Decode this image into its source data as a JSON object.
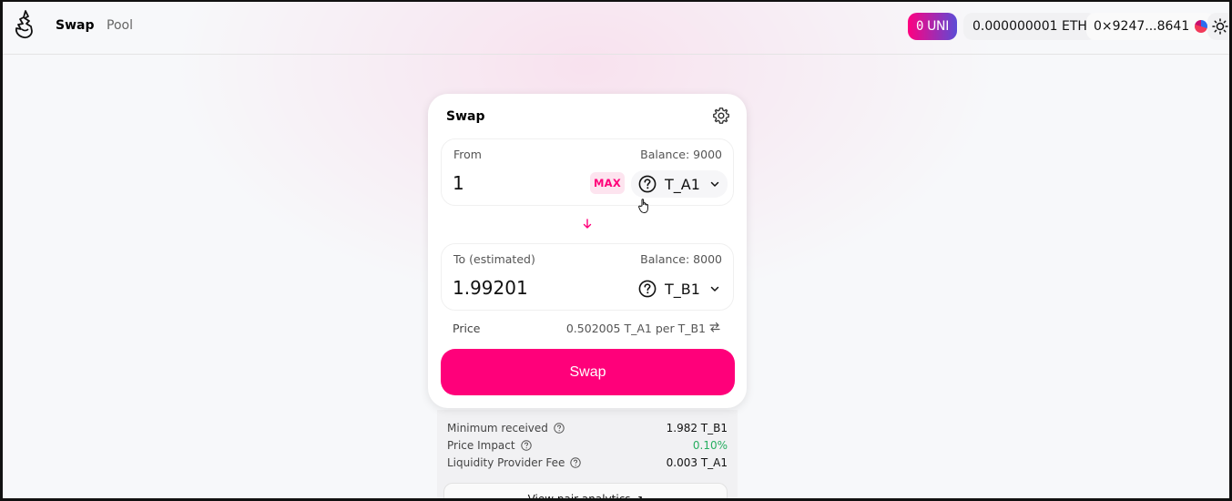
{
  "header": {
    "nav": {
      "swap": "Swap",
      "pool": "Pool"
    },
    "uni_balance": "0",
    "uni_label": "UNI",
    "eth_balance": "0.000000001 ETH",
    "account": "0×9247...8641",
    "icons": [
      "logo-icon",
      "avatar-icon",
      "sun-icon"
    ]
  },
  "swap_card": {
    "title": "Swap",
    "from": {
      "label": "From",
      "balance": "Balance: 9000",
      "amount": "1",
      "max": "MAX",
      "token": "T_A1"
    },
    "to": {
      "label": "To (estimated)",
      "balance": "Balance: 8000",
      "amount": "1.99201",
      "token": "T_B1"
    },
    "price": {
      "label": "Price",
      "value": "0.502005 T_A1 per T_B1"
    },
    "swap_button": "Swap"
  },
  "details": {
    "rows": [
      {
        "label": "Minimum received",
        "value": "1.982 T_B1"
      },
      {
        "label": "Price Impact",
        "value": "0.10%"
      },
      {
        "label": "Liquidity Provider Fee",
        "value": "0.003 T_A1"
      }
    ],
    "analytics_link": "View pair analytics ↗"
  },
  "colors": {
    "accent": "#ff007a",
    "positive": "#27ae60",
    "uni_gradient_start": "#ff0080",
    "uni_gradient_end": "#5b4bd6"
  }
}
